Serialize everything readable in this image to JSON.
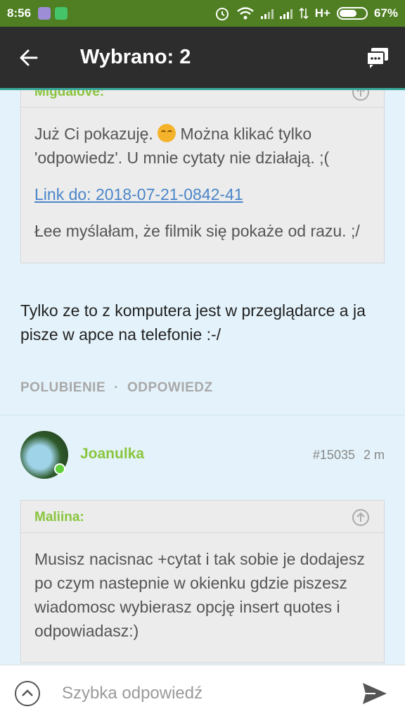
{
  "status": {
    "time": "8:56",
    "network": "H+",
    "battery_percent": "67%",
    "battery_level": 0.67
  },
  "appbar": {
    "title": "Wybrano: 2"
  },
  "quote1": {
    "author": "Migdalove:",
    "line1_before": "Już Ci pokazuję. ",
    "line1_after": " Można klikać tylko 'odpowiedz'. U mnie cytaty nie działają. ;(",
    "link": "Link do: 2018-07-21-0842-41",
    "line2": "Łee myślałam, że filmik się pokaże od razu. ;/"
  },
  "message1": "Tylko ze to z komputera jest w przeglądarce a ja pisze w apce na telefonie :-/",
  "actions": {
    "like": "POLUBIENIE",
    "separator": "·",
    "reply": "ODPOWIEDZ"
  },
  "post2": {
    "username": "Joanulka",
    "post_id": "#15035",
    "time": "2 m"
  },
  "quote2": {
    "author": "Maliina:",
    "text": "Musisz nacisnac +cytat i tak sobie je dodajesz po czym nastepnie w okienku gdzie piszesz wiadomosc wybierasz opcję insert quotes i odpowiadasz:)"
  },
  "input": {
    "placeholder": "Szybka odpowiedź"
  },
  "colors": {
    "statusbar": "#4f7f22",
    "appbar": "#2d2d2d",
    "accent": "#3aa99b",
    "username": "#8ac53e",
    "link": "#4a86c8",
    "background": "#e4f3fb"
  }
}
